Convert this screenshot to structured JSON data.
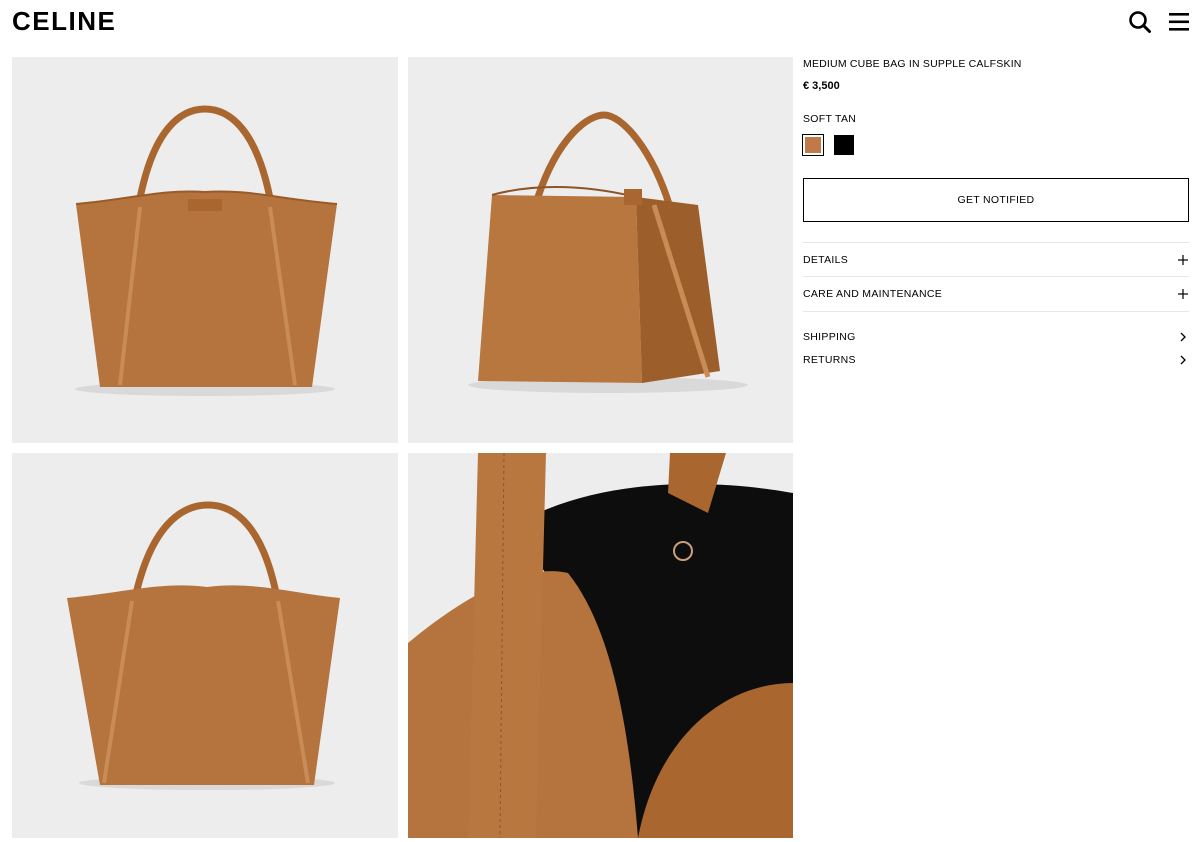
{
  "header": {
    "logo": "CELINE",
    "icons": [
      "search-icon",
      "menu-icon"
    ]
  },
  "gallery": {
    "images": [
      {
        "name": "bag-front-view"
      },
      {
        "name": "bag-three-quarter-view"
      },
      {
        "name": "bag-back-view"
      },
      {
        "name": "bag-interior-detail"
      }
    ]
  },
  "product": {
    "name": "MEDIUM CUBE BAG IN SUPPLE CALFSKIN",
    "price": "€ 3,500",
    "color_name": "SOFT TAN",
    "swatches": [
      {
        "color": "#c07a47",
        "selected": true
      },
      {
        "color": "#000000",
        "selected": false
      }
    ],
    "cta_label": "GET NOTIFIED",
    "accordions": [
      {
        "label": "DETAILS",
        "icon": "plus-icon"
      },
      {
        "label": "CARE AND MAINTENANCE",
        "icon": "plus-icon"
      }
    ],
    "links": [
      {
        "label": "SHIPPING",
        "icon": "chevron-right-icon"
      },
      {
        "label": "RETURNS",
        "icon": "chevron-right-icon"
      }
    ]
  },
  "colors": {
    "leather": "#b5733d",
    "tile_bg": "#ededed",
    "lining": "#0d0d0d"
  }
}
